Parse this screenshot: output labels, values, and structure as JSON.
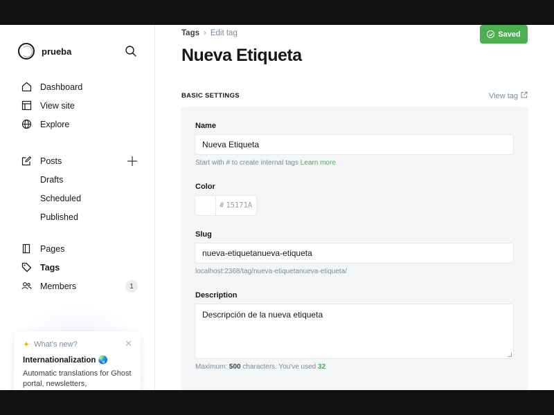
{
  "sidebar": {
    "brand": "prueba",
    "nav_primary": [
      {
        "label": "Dashboard",
        "icon": "home-icon"
      },
      {
        "label": "View site",
        "icon": "layout-icon"
      },
      {
        "label": "Explore",
        "icon": "globe-icon"
      }
    ],
    "posts": {
      "label": "Posts",
      "sub": [
        "Drafts",
        "Scheduled",
        "Published"
      ]
    },
    "nav_secondary": [
      {
        "label": "Pages",
        "icon": "pages-icon"
      },
      {
        "label": "Tags",
        "icon": "tag-icon",
        "active": true
      },
      {
        "label": "Members",
        "icon": "members-icon",
        "badge": "1"
      }
    ],
    "whats_new": {
      "heading": "What's new?",
      "title": "Internationalization 🌏",
      "body": "Automatic translations for Ghost portal, newsletters,"
    }
  },
  "main": {
    "breadcrumb": {
      "root": "Tags",
      "current": "Edit tag"
    },
    "saved_label": "Saved",
    "title": "Nueva Etiqueta",
    "section_label": "BASIC SETTINGS",
    "view_tag_label": "View tag",
    "form": {
      "name_label": "Name",
      "name_value": "Nueva Etiqueta",
      "name_hint": "Start with # to create internal tags",
      "name_hint_link": "Learn more",
      "color_label": "Color",
      "color_hash": "#",
      "color_placeholder": "15171A",
      "slug_label": "Slug",
      "slug_value": "nueva-etiquetanueva-etiqueta",
      "slug_url": "localhost:2368/tag/nueva-etiquetanueva-etiqueta/",
      "description_label": "Description",
      "description_value": "Descripción de la nueva etiqueta",
      "desc_hint_prefix": "Maximum:",
      "desc_max": "500",
      "desc_hint_mid": "characters. You've used",
      "desc_used": "32"
    }
  },
  "colors": {
    "accent_green": "#4caf50",
    "text_dark": "#15171a",
    "panel_bg": "#f4f5f6"
  }
}
